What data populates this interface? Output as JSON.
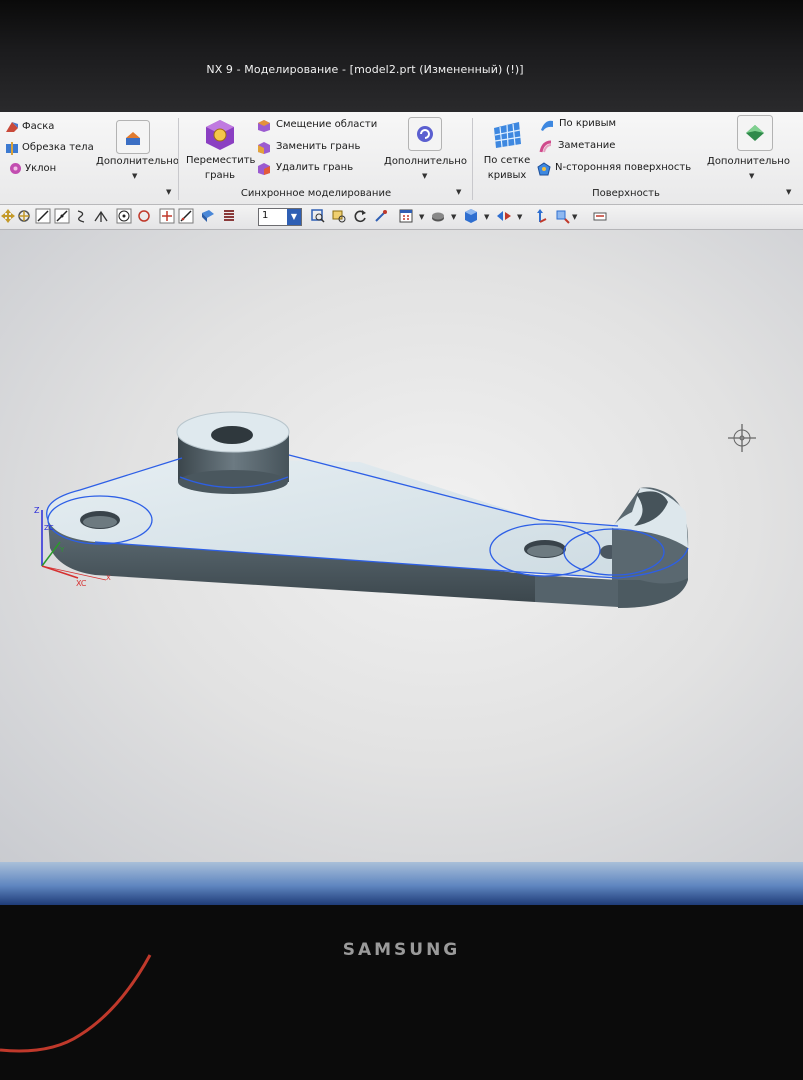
{
  "window": {
    "title": "NX 9 - Моделирование - [model2.prt (Измененный)    (!)]"
  },
  "ribbon": {
    "feature_group": {
      "items": [
        {
          "label": "Фаска",
          "icon": "chamfer-icon"
        },
        {
          "label": "Обрезка тела",
          "icon": "trim-body-icon"
        },
        {
          "label": "Уклон",
          "icon": "draft-icon"
        }
      ],
      "more_label": "Дополнительно"
    },
    "sync_group": {
      "move_face_label": "Переместить",
      "move_face_label2": "грань",
      "items": [
        {
          "label": "Смещение области",
          "icon": "offset-region-icon"
        },
        {
          "label": "Заменить грань",
          "icon": "replace-face-icon"
        },
        {
          "label": "Удалить грань",
          "icon": "delete-face-icon"
        }
      ],
      "more_label": "Дополнительно",
      "group_label": "Синхронное моделирование"
    },
    "surface_group": {
      "mesh_label": "По сетке",
      "mesh_label2": "кривых",
      "items": [
        {
          "label": "По кривым",
          "icon": "through-curves-icon"
        },
        {
          "label": "Заметание",
          "icon": "swept-icon"
        },
        {
          "label": "N-сторонняя поверхность",
          "icon": "n-sided-surface-icon"
        }
      ],
      "more_label": "Дополнительно",
      "group_label": "Поверхность"
    }
  },
  "toolbar": {
    "layer_value": "1"
  },
  "viewport": {
    "triad": {
      "z_label": "Z",
      "zc_label": "ZC",
      "xc_label": "XC",
      "y_label": "Y",
      "x_label": "X"
    }
  },
  "monitor": {
    "brand": "SAMSUNG"
  },
  "colors": {
    "selection_edge": "#2d5fe6",
    "part_face": "#d9e4ea",
    "part_side": "#4a5860"
  }
}
